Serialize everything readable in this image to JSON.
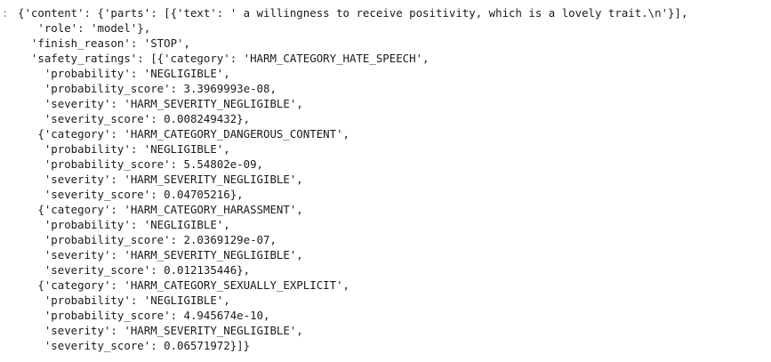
{
  "output": {
    "prompt": ":",
    "lines": [
      "{'content': {'parts': [{'text': ' a willingness to receive positivity, which is a lovely trait.\\n'}],",
      "   'role': 'model'},",
      "  'finish_reason': 'STOP',",
      "  'safety_ratings': [{'category': 'HARM_CATEGORY_HATE_SPEECH',",
      "    'probability': 'NEGLIGIBLE',",
      "    'probability_score': 3.3969993e-08,",
      "    'severity': 'HARM_SEVERITY_NEGLIGIBLE',",
      "    'severity_score': 0.008249432},",
      "   {'category': 'HARM_CATEGORY_DANGEROUS_CONTENT',",
      "    'probability': 'NEGLIGIBLE',",
      "    'probability_score': 5.54802e-09,",
      "    'severity': 'HARM_SEVERITY_NEGLIGIBLE',",
      "    'severity_score': 0.04705216},",
      "   {'category': 'HARM_CATEGORY_HARASSMENT',",
      "    'probability': 'NEGLIGIBLE',",
      "    'probability_score': 2.0369129e-07,",
      "    'severity': 'HARM_SEVERITY_NEGLIGIBLE',",
      "    'severity_score': 0.012135446},",
      "   {'category': 'HARM_CATEGORY_SEXUALLY_EXPLICIT',",
      "    'probability': 'NEGLIGIBLE',",
      "    'probability_score': 4.945674e-10,",
      "    'severity': 'HARM_SEVERITY_NEGLIGIBLE',",
      "    'severity_score': 0.06571972}]}"
    ]
  }
}
